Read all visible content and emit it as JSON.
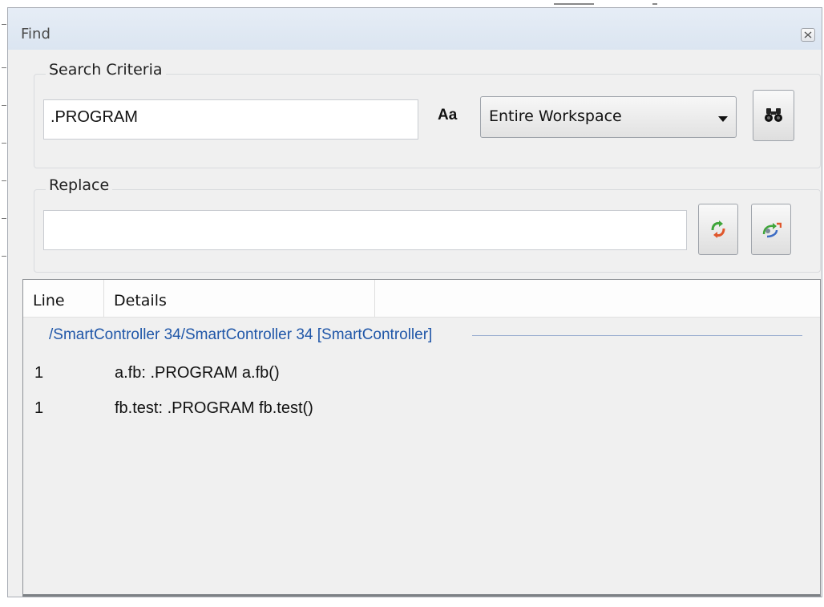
{
  "panel": {
    "title": "Find"
  },
  "search": {
    "group_label": "Search Criteria",
    "query_value": ".PROGRAM",
    "case_label": "Aa",
    "scope": {
      "selected": "Entire Workspace"
    }
  },
  "replace": {
    "group_label": "Replace",
    "value": ""
  },
  "results": {
    "columns": [
      "Line",
      "Details"
    ],
    "groups": [
      {
        "path": "/SmartController 34/SmartController 34 [SmartController]",
        "rows": [
          {
            "line": "1",
            "details": "a.fb: .PROGRAM a.fb()"
          },
          {
            "line": "1",
            "details": "fb.test: .PROGRAM fb.test()"
          }
        ]
      }
    ]
  },
  "icons": {
    "close": "close-icon",
    "search": "binoculars-icon",
    "replace": "replace-icon",
    "replace_all": "replace-all-icon",
    "dropdown": "chevron-down-icon"
  },
  "colors": {
    "titlebar": "#dbe5f1",
    "group_path": "#1f56a8",
    "panel_bg": "#f0f0f0"
  }
}
